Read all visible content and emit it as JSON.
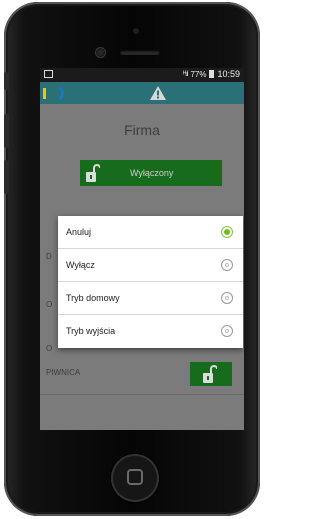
{
  "status_bar": {
    "signal": "ᴴ.ıl",
    "battery": "77%",
    "time": "10:59"
  },
  "app": {
    "logo_icon": "app-logo-icon",
    "alert_icon": "warning-icon",
    "accent": "#2b6f77"
  },
  "page": {
    "title": "Firma",
    "status_button": {
      "label": "Wyłączony",
      "icon": "unlock-icon",
      "color": "#176b1c"
    },
    "row_labels": [
      "D",
      "O",
      "O"
    ],
    "piwnica_label": "PIWNICA"
  },
  "dialog": {
    "options": [
      {
        "label": "Anuluj",
        "selected": true
      },
      {
        "label": "Wyłącz",
        "selected": false
      },
      {
        "label": "Tryb domowy",
        "selected": false
      },
      {
        "label": "Tryb wyjścia",
        "selected": false
      }
    ]
  }
}
